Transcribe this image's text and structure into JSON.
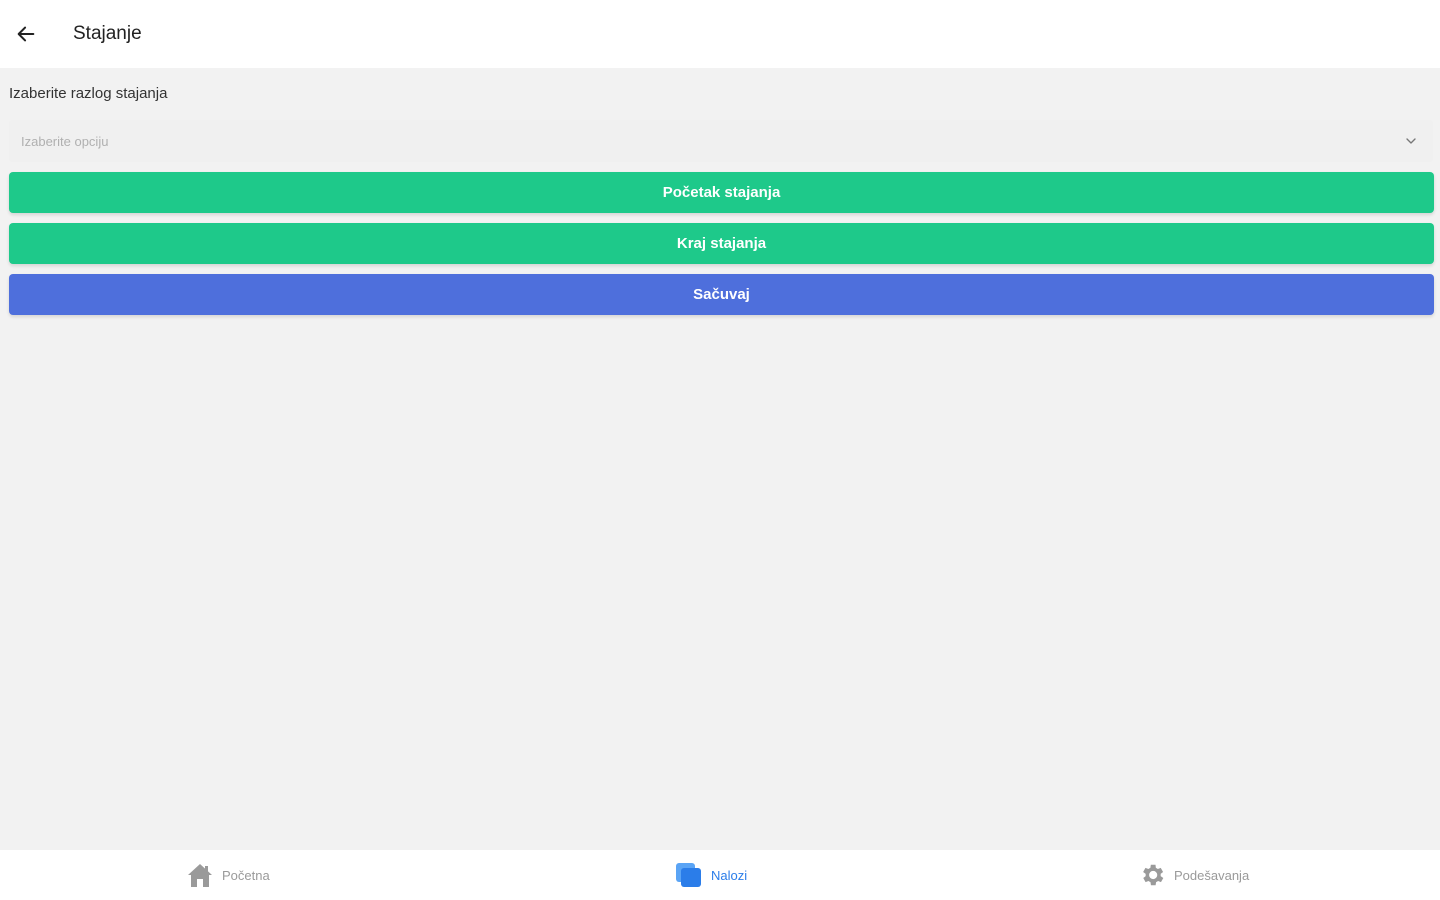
{
  "header": {
    "title": "Stajanje",
    "back_icon": "arrow-left-icon"
  },
  "form": {
    "reason_label": "Izaberite razlog stajanja",
    "reason_select": {
      "placeholder": "Izaberite opciju",
      "icon": "chevron-down-icon"
    }
  },
  "buttons": {
    "start_label": "Početak stajanja",
    "end_label": "Kraj stajanja",
    "save_label": "Sačuvaj"
  },
  "bottom_nav": {
    "items": [
      {
        "label": "Početna",
        "icon": "home-icon",
        "active": false
      },
      {
        "label": "Nalozi",
        "icon": "orders-icon",
        "active": true
      },
      {
        "label": "Podešavanja",
        "icon": "gear-icon",
        "active": false
      }
    ]
  },
  "colors": {
    "green": "#1ec98a",
    "blue": "#4e6fdc",
    "active_nav": "#2b7de9",
    "inactive_nav": "#9a9a9a",
    "background": "#f2f2f2"
  }
}
